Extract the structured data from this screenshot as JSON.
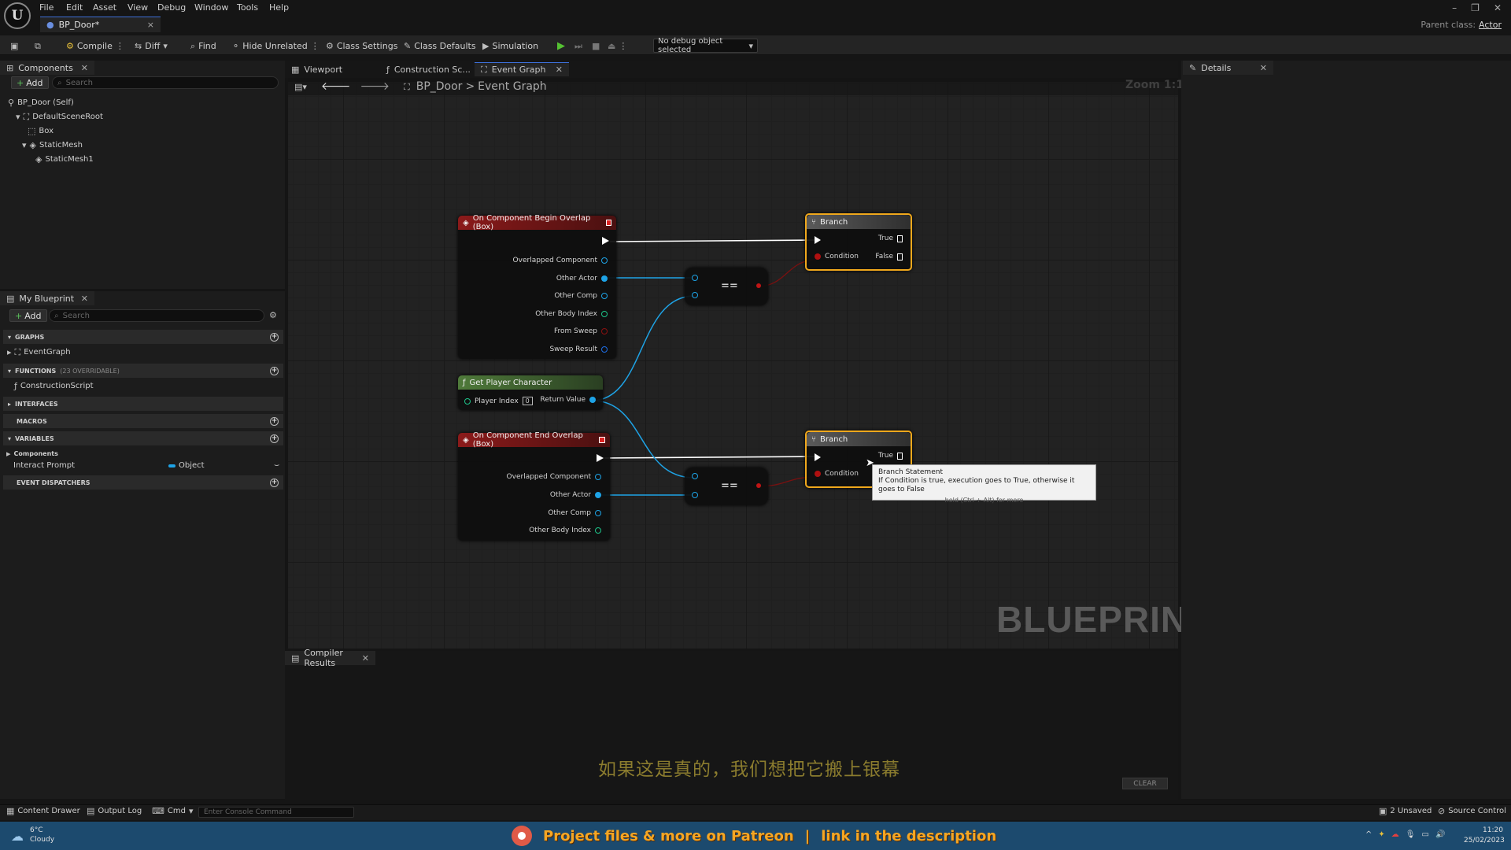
{
  "menu": {
    "items": [
      "File",
      "Edit",
      "Asset",
      "View",
      "Debug",
      "Window",
      "Tools",
      "Help"
    ]
  },
  "tab": {
    "title": "BP_Door*",
    "close": "×"
  },
  "parent_class": {
    "label": "Parent class:",
    "value": "Actor"
  },
  "toolbar": {
    "compile": "Compile",
    "diff": "Diff",
    "find": "Find",
    "hide_unrelated": "Hide Unrelated",
    "class_settings": "Class Settings",
    "class_defaults": "Class Defaults",
    "simulation": "Simulation",
    "debug_object": "No debug object selected"
  },
  "components": {
    "title": "Components",
    "add": "Add",
    "search_placeholder": "Search",
    "tree": [
      "BP_Door (Self)",
      "DefaultSceneRoot",
      "Box",
      "StaticMesh",
      "StaticMesh1"
    ]
  },
  "my_blueprint": {
    "title": "My Blueprint",
    "add": "Add",
    "search_placeholder": "Search",
    "graphs": "GRAPHS",
    "event_graph": "EventGraph",
    "functions": "FUNCTIONS",
    "functions_count": "(23 OVERRIDABLE)",
    "construction_script": "ConstructionScript",
    "interfaces": "INTERFACES",
    "macros": "MACROS",
    "variables": "VARIABLES",
    "var_category": "Components",
    "var_name": "Interact Prompt",
    "var_type": "Object",
    "event_dispatchers": "EVENT DISPATCHERS"
  },
  "graph_tabs": {
    "viewport": "Viewport",
    "construction": "Construction Sc...",
    "event_graph": "Event Graph"
  },
  "breadcrumb": {
    "bp": "BP_Door",
    "sep": ">",
    "graph": "Event Graph"
  },
  "zoom": "Zoom 1:1",
  "watermark": "BLUEPRINT",
  "nodes": {
    "begin_overlap": {
      "title": "On Component Begin Overlap (Box)",
      "pins": [
        "Overlapped Component",
        "Other Actor",
        "Other Comp",
        "Other Body Index",
        "From Sweep",
        "Sweep Result"
      ]
    },
    "end_overlap": {
      "title": "On Component End Overlap (Box)",
      "pins": [
        "Overlapped Component",
        "Other Actor",
        "Other Comp",
        "Other Body Index"
      ]
    },
    "get_player": {
      "title": "Get Player Character",
      "player_index": "Player Index",
      "index_value": "0",
      "return_value": "Return Value"
    },
    "branch1": {
      "title": "Branch",
      "true": "True",
      "false": "False",
      "condition": "Condition"
    },
    "branch2": {
      "title": "Branch",
      "true": "True",
      "condition": "Condition"
    },
    "equal": "=="
  },
  "tooltip": {
    "title": "Branch Statement",
    "body": "If Condition is true, execution goes to True, otherwise it goes to False",
    "hint": "hold (Ctrl + Alt) for more"
  },
  "details": {
    "title": "Details"
  },
  "compiler": {
    "title": "Compiler Results",
    "clear": "CLEAR"
  },
  "subtitle": "如果这是真的，我们想把它搬上银幕",
  "statusbar": {
    "content_drawer": "Content Drawer",
    "output_log": "Output Log",
    "cmd": "Cmd",
    "console_placeholder": "Enter Console Command",
    "unsaved": "2 Unsaved",
    "source_control": "Source Control"
  },
  "taskbar": {
    "temp": "6°C",
    "weather": "Cloudy",
    "time": "11:20",
    "date": "25/02/2023"
  },
  "banner": {
    "left": "Project files & more on Patreon",
    "sep": "|",
    "right": "link in the description"
  },
  "colors": {
    "accent": "#3d6fd8",
    "event_header": "#8b1a1a",
    "pure_header": "#4f7a3a",
    "branch_border": "#f0a81c",
    "pin_object": "#1ea3e6",
    "pin_int": "#1ec48a",
    "pin_bool": "#b01010"
  }
}
